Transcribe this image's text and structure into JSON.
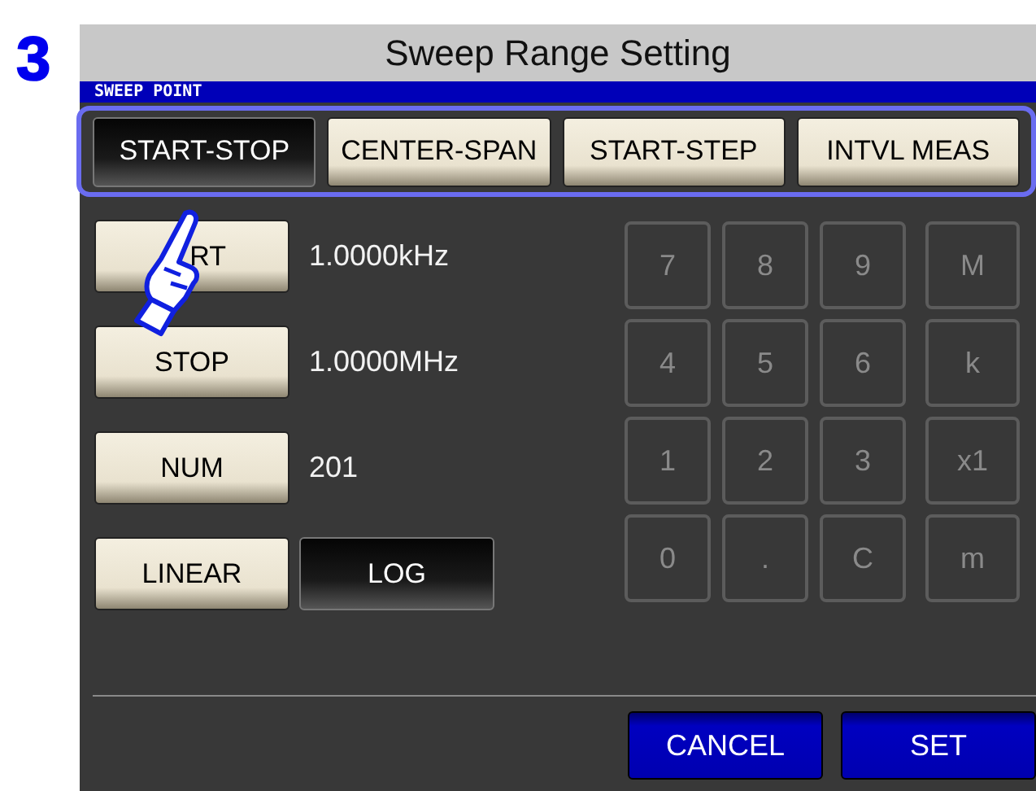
{
  "step": "3",
  "title": "Sweep Range Setting",
  "section": "SWEEP POINT",
  "modes": [
    {
      "label": "START-STOP",
      "selected": true
    },
    {
      "label": "CENTER-SPAN",
      "selected": false
    },
    {
      "label": "START-STEP",
      "selected": false
    },
    {
      "label": "INTVL MEAS",
      "selected": false
    }
  ],
  "params": [
    {
      "label": "RT",
      "value": "1.0000kHz"
    },
    {
      "label": "STOP",
      "value": "1.0000MHz"
    },
    {
      "label": "NUM",
      "value": "201"
    }
  ],
  "scale": [
    {
      "label": "LINEAR",
      "selected": false
    },
    {
      "label": "LOG",
      "selected": true
    }
  ],
  "keypad": {
    "disabled": true,
    "keys": [
      "7",
      "8",
      "9",
      "M",
      "4",
      "5",
      "6",
      "k",
      "1",
      "2",
      "3",
      "x1",
      "0",
      ".",
      "C",
      "m"
    ]
  },
  "buttons": [
    "CANCEL",
    "SET"
  ]
}
